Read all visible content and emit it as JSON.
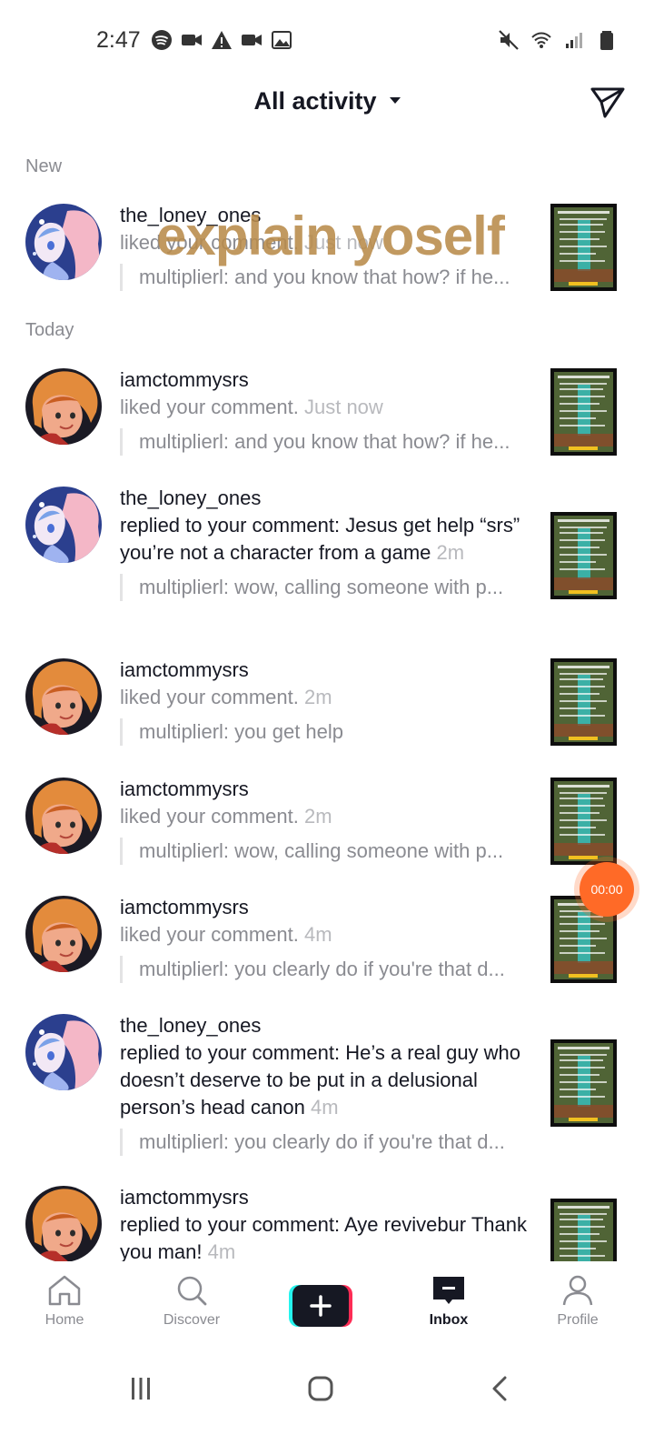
{
  "status_bar": {
    "time": "2:47"
  },
  "header": {
    "title": "All activity"
  },
  "overlay_caption": "explain yoself",
  "sections": {
    "new": "New",
    "today": "Today"
  },
  "items": [
    {
      "user": "the_loney_ones",
      "avatar": "anime",
      "text": "liked your comment.",
      "time": "Just now",
      "quote": "multiplierl: and you know that how? if he..."
    },
    {
      "user": "iamctommysrs",
      "avatar": "redhead",
      "text": "liked your comment.",
      "time": "Just now",
      "quote": "multiplierl: and you know that how? if he..."
    },
    {
      "user": "the_loney_ones",
      "avatar": "anime",
      "text": "replied to your comment: Jesus get help “srs” you’re not a character from a game",
      "time": "2m",
      "quote": "multiplierl: wow, calling someone with p..."
    },
    {
      "user": "iamctommysrs",
      "avatar": "redhead",
      "text": "liked your comment.",
      "time": "2m",
      "quote": "multiplierl: you get help"
    },
    {
      "user": "iamctommysrs",
      "avatar": "redhead",
      "text": "liked your comment.",
      "time": "2m",
      "quote": "multiplierl: wow, calling someone with p..."
    },
    {
      "user": "iamctommysrs",
      "avatar": "redhead",
      "text": "liked your comment.",
      "time": "4m",
      "quote": "multiplierl: you clearly do if you're that d..."
    },
    {
      "user": "the_loney_ones",
      "avatar": "anime",
      "text": "replied to your comment: He’s a real guy who doesn’t deserve to be put in a delusional person’s head canon",
      "time": "4m",
      "quote": "multiplierl: you clearly do if you're that d..."
    },
    {
      "user": "iamctommysrs",
      "avatar": "redhead",
      "text": "replied to your comment: Aye revivebur Thank you man!",
      "time": "4m",
      "quote": ""
    }
  ],
  "timer": "00:00",
  "nav": {
    "home": "Home",
    "discover": "Discover",
    "inbox": "Inbox",
    "profile": "Profile"
  },
  "colors": {
    "accent_orange": "#ff6a27",
    "tiktok_cyan": "#25f4ee",
    "tiktok_red": "#fe2c55"
  }
}
